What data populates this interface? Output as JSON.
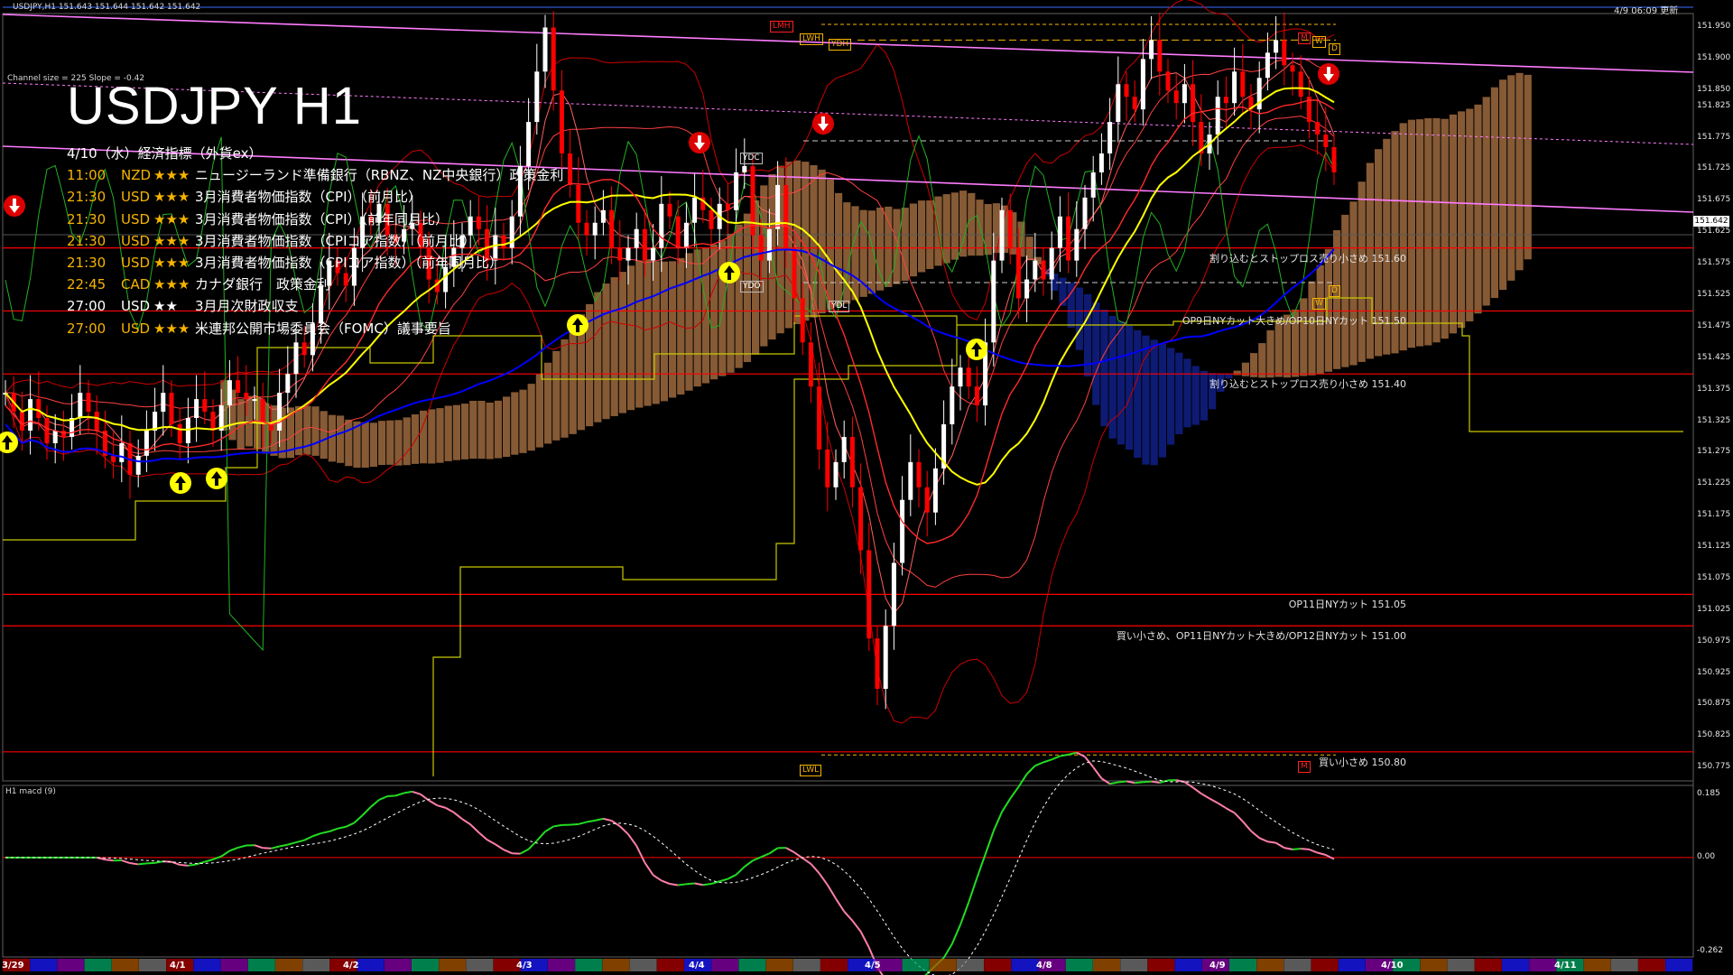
{
  "header": {
    "title": "USDJPY H1",
    "ohlc_line": "USDJPY,H1 151.643 151.644 151.642 151.642",
    "channel_line": "Channel size = 225 Slope = -0.42",
    "updated": "4/9 06:09 更新",
    "indicator_label": "H1 macd (9)"
  },
  "events": {
    "heading": "4/10（水）経済指標（外貨ex）",
    "rows": [
      {
        "time": "11:00",
        "cur": "NZD",
        "stars": "★★★",
        "name": "ニュージーランド準備銀行（RBNZ、NZ中央銀行）政策金利",
        "color": "#f6b400"
      },
      {
        "time": "21:30",
        "cur": "USD",
        "stars": "★★★",
        "name": "3月消費者物価指数（CPI）（前月比）",
        "color": "#f6b400"
      },
      {
        "time": "21:30",
        "cur": "USD",
        "stars": "★★★",
        "name": "3月消費者物価指数（CPI）（前年同月比）",
        "color": "#f6b400"
      },
      {
        "time": "21:30",
        "cur": "USD",
        "stars": "★★★",
        "name": "3月消費者物価指数（CPIコア指数）（前月比）",
        "color": "#f6b400"
      },
      {
        "time": "21:30",
        "cur": "USD",
        "stars": "★★★",
        "name": "3月消費者物価指数（CPIコア指数）（前年同月比）",
        "color": "#f6b400"
      },
      {
        "time": "22:45",
        "cur": "CAD",
        "stars": "★★★",
        "name": "カナダ銀行　政策金利",
        "color": "#f6b400"
      },
      {
        "time": "27:00",
        "cur": "USD",
        "stars": "★★",
        "name": "3月月次財政収支",
        "color": "#ffffff"
      },
      {
        "time": "27:00",
        "cur": "USD",
        "stars": "★★★",
        "name": "米連邦公開市場委員会（FOMC）議事要旨",
        "color": "#f6b400"
      }
    ]
  },
  "price_levels": [
    {
      "price": 151.6,
      "label": "割り込むとストップロス売り小さめ 151.60"
    },
    {
      "price": 151.5,
      "label": "OP9日NYカット大きめ/OP10日NYカット 151.50"
    },
    {
      "price": 151.4,
      "label": "割り込むとストップロス売り小さめ 151.40"
    },
    {
      "price": 151.05,
      "label": "OP11日NYカット 151.05"
    },
    {
      "price": 151.0,
      "label": "買い小さめ、OP11日NYカット大きめ/OP12日NYカット 151.00"
    },
    {
      "price": 150.8,
      "label": "買い小さめ 150.80"
    }
  ],
  "tags": {
    "lwh": "LWH",
    "lmh": "LMH",
    "ydh": "YDH",
    "ydc": "YDC",
    "ydo": "YDO",
    "ydl": "YDL",
    "lwl": "LWL",
    "w1": "W",
    "d1": "D",
    "m1": "M",
    "d2": "D",
    "w2": "W",
    "m2": "M"
  },
  "colors": {
    "bull": "#ffffff",
    "bear": "#ff0000",
    "ma_yellow": "#ffff00",
    "ma_blue": "#0000ff",
    "cloud_bull": "#f4a460",
    "cloud_bear": "#1e3cff",
    "macd_up": "#22dd22",
    "macd_down": "#ff7faa"
  },
  "chart_data": {
    "type": "candlestick",
    "symbol": "USDJPY",
    "timeframe": "H1",
    "current_price": 151.642,
    "price_axis": {
      "ylim": [
        150.761,
        151.965
      ],
      "ticks": [
        "151.950",
        "151.900",
        "151.850",
        "151.825",
        "151.775",
        "151.725",
        "151.675",
        "151.625",
        "151.575",
        "151.525",
        "151.475",
        "151.425",
        "151.375",
        "151.325",
        "151.275",
        "151.225",
        "151.175",
        "151.125",
        "151.075",
        "151.025",
        "150.975",
        "150.925",
        "150.875",
        "150.825",
        "150.775"
      ],
      "current_label": "151.642"
    },
    "macd_axis": {
      "ylim": [
        -0.27,
        0.19
      ],
      "ticks": [
        "0.185",
        "0.00",
        "-0.262"
      ]
    },
    "date_ticks": [
      "3/29",
      "4/1",
      "4/2",
      "4/3",
      "4/4",
      "4/5",
      "4/8",
      "4/9",
      "4/10",
      "4/11"
    ],
    "close": [
      151.37,
      151.34,
      151.31,
      151.36,
      151.33,
      151.29,
      151.31,
      151.3,
      151.33,
      151.37,
      151.34,
      151.31,
      151.27,
      151.26,
      151.29,
      151.24,
      151.27,
      151.31,
      151.34,
      151.37,
      151.32,
      151.29,
      151.33,
      151.36,
      151.34,
      151.31,
      151.35,
      151.39,
      151.37,
      151.36,
      151.36,
      151.32,
      151.31,
      151.37,
      151.4,
      151.45,
      151.43,
      151.48,
      151.54,
      151.58,
      151.56,
      151.54,
      151.6,
      151.65,
      151.64,
      151.67,
      151.62,
      151.61,
      151.63,
      151.64,
      151.6,
      151.55,
      151.53,
      151.57,
      151.6,
      151.62,
      151.65,
      151.63,
      151.58,
      151.62,
      151.6,
      151.65,
      151.73,
      151.8,
      151.88,
      151.95,
      151.85,
      151.75,
      151.7,
      151.64,
      151.62,
      151.64,
      151.66,
      151.6,
      151.58,
      151.6,
      151.63,
      151.58,
      151.6,
      151.67,
      151.65,
      151.6,
      151.64,
      151.68,
      151.66,
      151.63,
      151.67,
      151.66,
      151.72,
      151.73,
      151.62,
      151.58,
      151.63,
      151.7,
      151.6,
      151.52,
      151.45,
      151.38,
      151.28,
      151.22,
      151.26,
      151.3,
      151.22,
      151.12,
      150.98,
      150.9,
      151.0,
      151.1,
      151.2,
      151.26,
      151.22,
      151.18,
      151.25,
      151.32,
      151.38,
      151.41,
      151.38,
      151.35,
      151.45,
      151.58,
      151.66,
      151.6,
      151.52,
      151.55,
      151.58,
      151.55,
      151.6,
      151.65,
      151.58,
      151.63,
      151.68,
      151.72,
      151.75,
      151.8,
      151.86,
      151.84,
      151.82,
      151.9,
      151.93,
      151.88,
      151.85,
      151.83,
      151.86,
      151.8,
      151.75,
      151.78,
      151.84,
      151.83,
      151.88,
      151.84,
      151.82,
      151.87,
      151.91,
      151.93,
      151.89,
      151.88,
      151.84,
      151.8,
      151.78,
      151.76,
      151.72
    ],
    "annotated_levels": {
      "LWH": 151.955,
      "LMH": 151.965,
      "YDH": 151.93,
      "YDC": 151.77,
      "YDO": 151.545,
      "YDL": 151.52,
      "LWL": 150.795
    }
  }
}
